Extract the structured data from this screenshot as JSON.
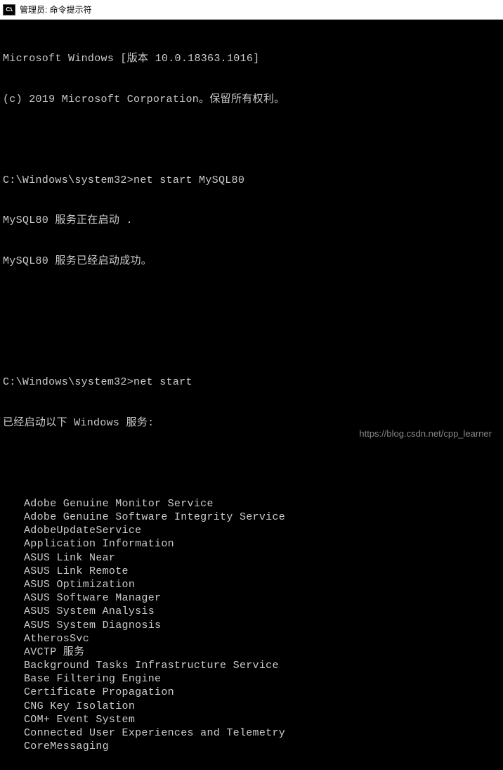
{
  "window": {
    "icon_text": "C:\\.",
    "title": "管理员: 命令提示符"
  },
  "terminal": {
    "header1": "Microsoft Windows [版本 10.0.18363.1016]",
    "header2": "(c) 2019 Microsoft Corporation。保留所有权利。",
    "prompt1_path": "C:\\Windows\\system32>",
    "prompt1_cmd": "net start MySQL80",
    "mysql_line1": "MySQL80 服务正在启动 .",
    "mysql_line2": "MySQL80 服务已经启动成功。",
    "prompt2_path": "C:\\Windows\\system32>",
    "prompt2_cmd": "net start",
    "services_header": "已经启动以下 Windows 服务:",
    "services": [
      "Adobe Genuine Monitor Service",
      "Adobe Genuine Software Integrity Service",
      "AdobeUpdateService",
      "Application Information",
      "ASUS Link Near",
      "ASUS Link Remote",
      "ASUS Optimization",
      "ASUS Software Manager",
      "ASUS System Analysis",
      "ASUS System Diagnosis",
      "AtherosSvc",
      "AVCTP 服务",
      "Background Tasks Infrastructure Service",
      "Base Filtering Engine",
      "Certificate Propagation",
      "CNG Key Isolation",
      "COM+ Event System",
      "Connected User Experiences and Telemetry",
      "CoreMessaging"
    ]
  },
  "watermark": "https://blog.csdn.net/cpp_learner"
}
